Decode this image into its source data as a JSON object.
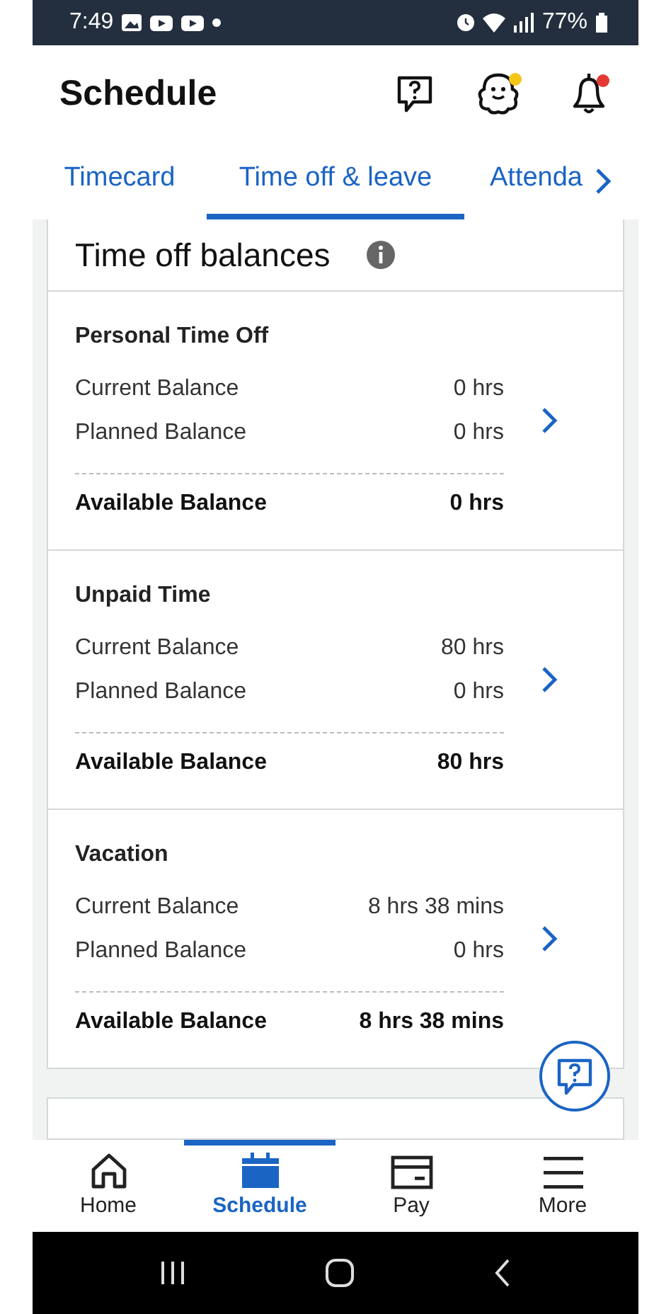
{
  "status_bar": {
    "time": "7:49",
    "battery": "77%"
  },
  "header": {
    "title": "Schedule",
    "waves_badge": true,
    "notifications_badge": true
  },
  "tabs": [
    {
      "label": "Timecard",
      "selected": false
    },
    {
      "label": "Time off & leave",
      "selected": true
    },
    {
      "label": "Attenda",
      "selected": false
    }
  ],
  "balances": {
    "title": "Time off balances",
    "sections": [
      {
        "name": "Personal Time Off",
        "rows": [
          {
            "label": "Current Balance",
            "value": "0 hrs"
          },
          {
            "label": "Planned Balance",
            "value": "0 hrs"
          }
        ],
        "available": {
          "label": "Available Balance",
          "value": "0 hrs"
        }
      },
      {
        "name": "Unpaid Time",
        "rows": [
          {
            "label": "Current Balance",
            "value": "80 hrs"
          },
          {
            "label": "Planned Balance",
            "value": "0 hrs"
          }
        ],
        "available": {
          "label": "Available Balance",
          "value": "80 hrs"
        }
      },
      {
        "name": "Vacation",
        "rows": [
          {
            "label": "Current Balance",
            "value": "8 hrs 38 mins"
          },
          {
            "label": "Planned Balance",
            "value": "0 hrs"
          }
        ],
        "available": {
          "label": "Available Balance",
          "value": "8 hrs 38 mins"
        }
      }
    ]
  },
  "bottom_nav": [
    {
      "kind": "home",
      "label": "Home",
      "selected": false
    },
    {
      "kind": "calendar",
      "label": "Schedule",
      "selected": true
    },
    {
      "kind": "card",
      "label": "Pay",
      "selected": false
    },
    {
      "kind": "menu",
      "label": "More",
      "selected": false
    }
  ]
}
